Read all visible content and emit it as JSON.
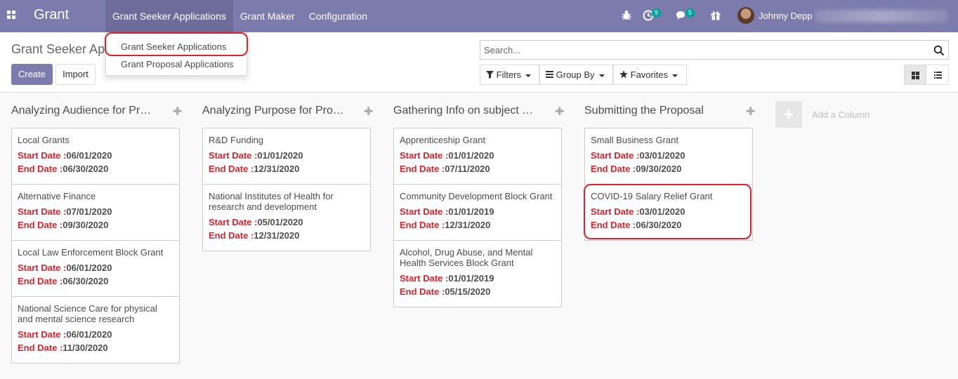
{
  "navbar": {
    "brand": "Grant",
    "menus": [
      "Grant Seeker Applications",
      "Grant Maker",
      "Configuration"
    ],
    "activity_count": "9",
    "messages_count": "5",
    "user_name": "Johnny Depp",
    "bg_color": "#7c7bad"
  },
  "dropdown": {
    "items": [
      "Grant Seeker Applications",
      "Grant Proposal Applications"
    ]
  },
  "control_panel": {
    "breadcrumb": "Grant Seeker Applications",
    "create_label": "Create",
    "import_label": "Import",
    "search_placeholder": "Search...",
    "filters_label": "Filters",
    "groupby_label": "Group By",
    "favorites_label": "Favorites"
  },
  "kanban": {
    "start_label": "Start Date :",
    "end_label": "End Date :",
    "add_column_label": "Add a Column",
    "columns": [
      {
        "title": "Analyzing Audience for Proposal",
        "cards": [
          {
            "name": "Local Grants",
            "start": "06/01/2020",
            "end": "06/30/2020"
          },
          {
            "name": "Alternative Finance",
            "start": "07/01/2020",
            "end": "09/30/2020"
          },
          {
            "name": "Local Law Enforcement Block Grant",
            "start": "06/01/2020",
            "end": "06/30/2020"
          },
          {
            "name": "National Science Care for physical and mental science research",
            "start": "06/01/2020",
            "end": "11/30/2020"
          }
        ]
      },
      {
        "title": "Analyzing Purpose for Proposal",
        "cards": [
          {
            "name": "R&D Funding",
            "start": "01/01/2020",
            "end": "12/31/2020"
          },
          {
            "name": "National Institutes of Health for research and development",
            "start": "05/01/2020",
            "end": "12/31/2020"
          }
        ]
      },
      {
        "title": "Gathering Info on subject matter",
        "cards": [
          {
            "name": "Apprenticeship Grant",
            "start": "01/01/2020",
            "end": "07/11/2020"
          },
          {
            "name": "Community Development Block Grant",
            "start": "01/01/2019",
            "end": "12/31/2020"
          },
          {
            "name": "Alcohol, Drug Abuse, and Mental Health Services Block Grant",
            "start": "01/01/2019",
            "end": "05/15/2020"
          }
        ]
      },
      {
        "title": "Submitting the Proposal",
        "cards": [
          {
            "name": "Small Business Grant",
            "start": "03/01/2020",
            "end": "09/30/2020"
          },
          {
            "name": "COVID-19 Salary Relief Grant",
            "start": "03/01/2020",
            "end": "06/30/2020"
          }
        ]
      }
    ]
  }
}
